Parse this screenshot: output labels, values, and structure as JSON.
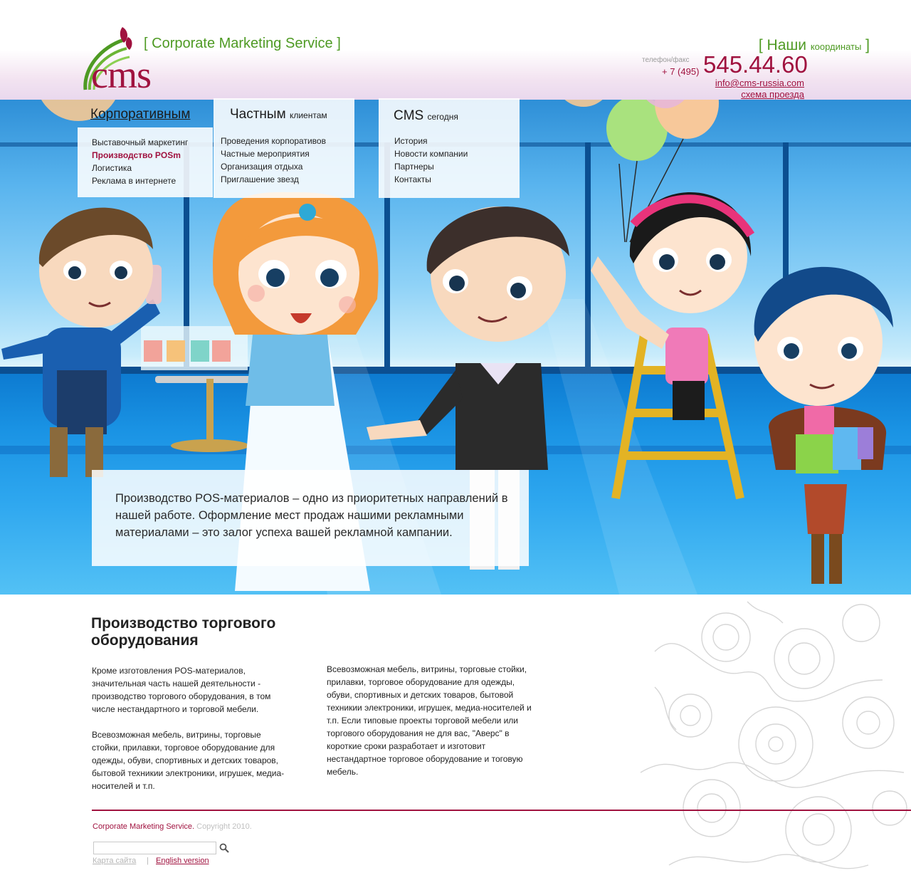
{
  "colors": {
    "brand": "#a0123f",
    "accent_green": "#4e9a23",
    "text": "#222222"
  },
  "header": {
    "logo_text": "cms",
    "tagline": "Corporate Marketing Service",
    "contacts_title": "Наши",
    "contacts_title_small": "координаты",
    "phone_label": "телефон/факс",
    "phone_code": "+ 7 (495)",
    "phone_number": "545.44.60",
    "email": "info@cms-russia.com",
    "map_link": "схема проезда"
  },
  "nav": {
    "corporate": {
      "title": "Корпоративным",
      "items": [
        "Выставочный маркетинг",
        "Производство POSm",
        "Логистика",
        "Реклама в интернете"
      ]
    },
    "private": {
      "title": "Частным",
      "title_small": "клиентам",
      "items": [
        "Проведения корпоративов",
        "Частные мероприятия",
        "Организация отдыха",
        "Приглашение звезд"
      ]
    },
    "cms": {
      "title": "CMS",
      "title_small": "сегодня",
      "items": [
        "История",
        "Новости компании",
        "Партнеры",
        "Контакты"
      ]
    }
  },
  "hero": {
    "quote": "Производство POS-материалов – одно из приоритетных направлений в нашей работе. Оформление мест продаж нашими рекламными материалами – это залог успеха вашей рекламной кампании."
  },
  "content": {
    "heading": "Производство торгового оборудования",
    "left_p1": "Кроме изготовления POS-материалов, значительная часть нашей деятельности - производство торгового оборудования, в том числе нестандартного и торговой мебели.",
    "left_p2": "Всевозможная мебель, витрины, торговые стойки, прилавки, торговое оборудование для одежды, обуви, спортивных и детских товаров, бытовой техникии электроники, игрушек, медиа-носителей  и т.п.",
    "right_p1": "Всевозможная мебель, витрины, торговые стойки, прилавки, торговое оборудование для одежды, обуви, спортивных и детских товаров, бытовой техникии электроники, игрушек, медиа-носителей  и т.п. Если типовые проекты торговой мебели или торгового оборудования не для вас, \"Аверс\" в короткие сроки разработает и изготовит нестандартное торговое оборудование и тоговую мебель."
  },
  "footer": {
    "company": "Corporate Marketing Service.",
    "copyright": "Copyright 2010.",
    "search_value": "",
    "sitemap": "Карта сайта",
    "divider": "|",
    "english": "English version",
    "search_icon": "magnifier-icon"
  }
}
